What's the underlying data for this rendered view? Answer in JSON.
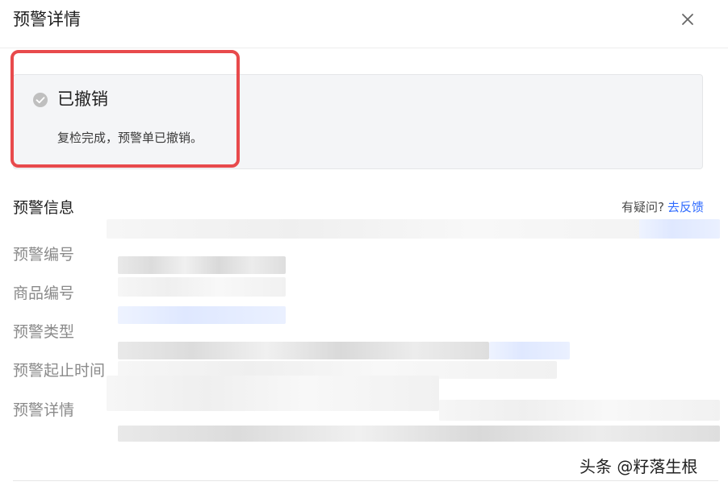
{
  "dialog": {
    "title": "预警详情",
    "close_icon": "close-icon"
  },
  "status": {
    "icon": "check-circle-icon",
    "icon_color": "#bfbfbf",
    "title": "已撤销",
    "description": "复检完成，预警单已撤销。"
  },
  "highlight_color": "#e84a4c",
  "info": {
    "section_title": "预警信息",
    "feedback_prefix": "有疑问?",
    "feedback_link": "去反馈",
    "link_color": "#2f6bff",
    "labels": {
      "alert_id": "预警编号",
      "product_id": "商品编号",
      "alert_type": "预警类型",
      "time_range": "预警起止时间",
      "alert_detail": "预警详情"
    }
  },
  "watermark": "头条 @籽落生根"
}
